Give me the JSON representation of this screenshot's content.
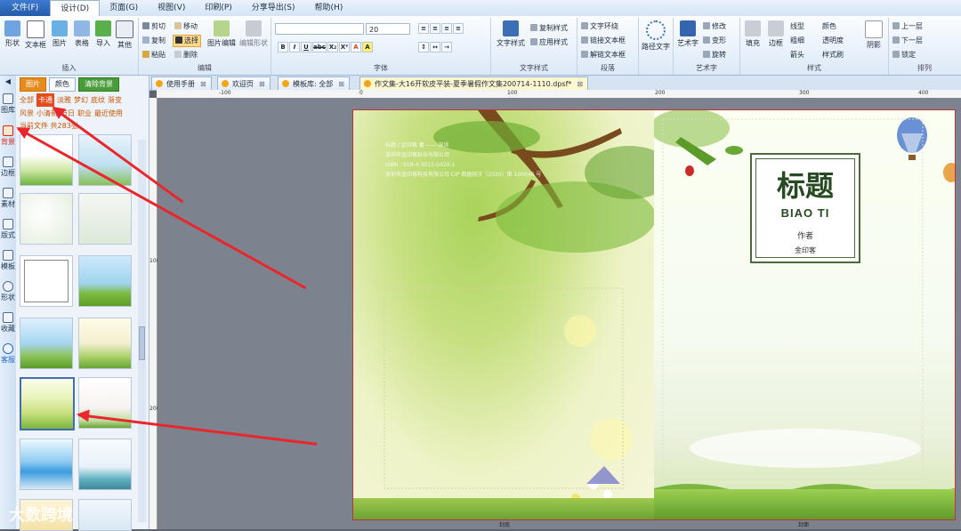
{
  "menu": [
    "文件(F)",
    "设计(D)",
    "页面(G)",
    "视图(V)",
    "印刷(P)",
    "分享导出(S)",
    "帮助(H)"
  ],
  "ribbon": {
    "insert": {
      "buttons": [
        "形状",
        "文本框",
        "图片",
        "表格",
        "导入",
        "其他"
      ],
      "label": "插入"
    },
    "edit": {
      "items": [
        "剪切",
        "复制",
        "粘贴",
        "移动",
        "选择",
        "删除",
        "图片编辑",
        "编辑形状"
      ],
      "label": "编辑"
    },
    "font": {
      "size": "20",
      "buttons": [
        "B",
        "I",
        "U",
        "abc",
        "X₂",
        "X²",
        "A",
        "A"
      ],
      "label": "字体"
    },
    "text_style": {
      "big": "文字样式",
      "items": [
        "复制样式",
        "应用样式"
      ],
      "label": "文字样式"
    },
    "paragraph": {
      "items": [
        "文字环绕",
        "链接文本框",
        "解链文本框"
      ],
      "label": "段落"
    },
    "path_text": {
      "big": "路径文字"
    },
    "art_text": {
      "big": "艺术字",
      "items": [
        "修改",
        "变形",
        "旋转"
      ],
      "label": "艺术字"
    },
    "style": {
      "fill": "填充",
      "border": "边框",
      "items": [
        "线型",
        "粗细",
        "箭头",
        "颜色",
        "透明度",
        "样式刷"
      ],
      "shadow": "阴影",
      "label": "样式"
    },
    "arrange": {
      "items": [
        "上一层",
        "下一层",
        "锁定"
      ],
      "label": "排列"
    }
  },
  "left_tools": [
    "图库",
    "背景",
    "边框",
    "素材",
    "版式",
    "模板",
    "形状",
    "收藏",
    "客服"
  ],
  "panel": {
    "tabs": [
      "图片",
      "颜色",
      "清除背景"
    ],
    "categories": [
      "全部",
      "卡通",
      "淡雅",
      "梦幻",
      "底纹",
      "渐变",
      "风景",
      "小清新",
      "节日",
      "职业",
      "最近使用"
    ],
    "count": "当前文件 共283张"
  },
  "doc_tabs": [
    "使用手册",
    "欢迎页",
    "模板库: 全部",
    "作文集-大16开软皮平装-夏季暑假作文集200714-1110.dpsf*"
  ],
  "rulers": {
    "h": [
      "-100",
      "0",
      "100",
      "200",
      "300",
      "400"
    ],
    "v": [
      "100",
      "200"
    ]
  },
  "cover": {
    "title": "标题",
    "pinyin": "BIAO TI",
    "author": "作者",
    "publisher": "金印客",
    "cip": [
      "标题 / 金印客 著 —— 深圳",
      "深圳市金印客科技有限公司",
      "ISBN : 919-4-3012-0420-1",
      "深圳市金印客科技有限公司 CIP 数据核字（2020）第 100046 号"
    ],
    "back_label": "封底",
    "front_label": "封面"
  },
  "watermark": "大数跨境",
  "colors": {
    "accent": "#e78b1d",
    "arrow": "#e8262c",
    "ribbon_blue": "#235ca8"
  }
}
